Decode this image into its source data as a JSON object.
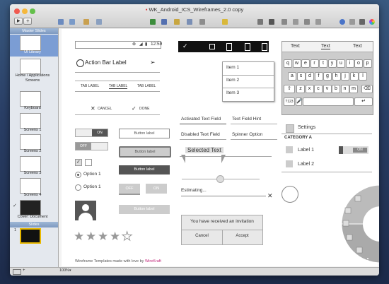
{
  "window": {
    "title": "WK_Android_ICS_Wireframes_2.0 copy"
  },
  "sidebar": {
    "master_header": "Master Slides",
    "items": [
      {
        "label": "UI Library"
      },
      {
        "label": "Home / Applications Screens"
      },
      {
        "label": "Keyboard"
      },
      {
        "label": "Screens 1"
      },
      {
        "label": "Screens 2"
      },
      {
        "label": "Screens 3"
      },
      {
        "label": "Screens 4"
      },
      {
        "label": "Cover: Document"
      }
    ],
    "slides_header": "Slides"
  },
  "status": {
    "zoom": "100%"
  },
  "wireframe": {
    "status_time": "12:59",
    "action_bar_label": "Action Bar Label",
    "tabs": [
      "TAB LABEL",
      "TAB LABEL",
      "TAB LABEL"
    ],
    "cancel": "CANCEL",
    "done": "DONE",
    "toggle_on": "ON",
    "toggle_off": "OFF",
    "button_label": "Button label",
    "option1": "Option 1",
    "option2": "Option 1",
    "btn_off": "OFF",
    "btn_on": "ON",
    "list_items": [
      "Item 1",
      "Item 2",
      "Item 3"
    ],
    "activated_field": "Activated Text Field",
    "hint_field": "Text Field Hint",
    "disabled_field": "Disabled Text Field",
    "spinner": "Spinner Option",
    "selected_text": "Selected Text",
    "estimating": "Estimating...",
    "invitation": "You have received an invitation",
    "dialog_cancel": "Cancel",
    "dialog_accept": "Accept",
    "footer_text": "Wireframe Templates made with love by ",
    "footer_brand": "WireKraft",
    "kb_suggestions": [
      "Text",
      "Text",
      "Text"
    ],
    "kb_row1": [
      "q",
      "w",
      "e",
      "r",
      "t",
      "y",
      "u",
      "i",
      "o",
      "p"
    ],
    "kb_row2": [
      "a",
      "s",
      "d",
      "f",
      "g",
      "h",
      "j",
      "k",
      "l"
    ],
    "kb_row3": [
      "z",
      "x",
      "c",
      "v",
      "b",
      "n",
      "m"
    ],
    "kb_sym": "?123",
    "settings": "Settings",
    "category": "CATEGORY A",
    "label1": "Label 1",
    "label2": "Label 2",
    "toggle2_on": "ON"
  }
}
